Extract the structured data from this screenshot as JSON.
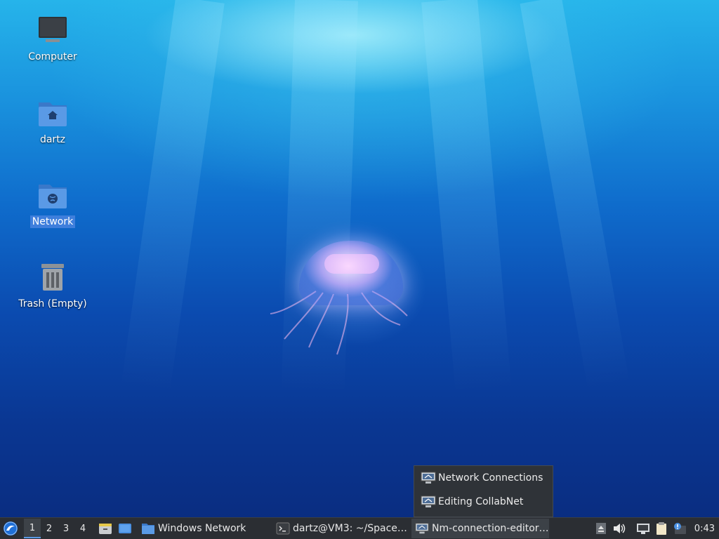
{
  "desktop": {
    "icons": [
      {
        "label": "Computer"
      },
      {
        "label": "dartz"
      },
      {
        "label": "Network"
      },
      {
        "label": "Trash (Empty)"
      }
    ]
  },
  "popup": {
    "items": [
      {
        "label": "Network Connections",
        "icon": "network-connections-icon"
      },
      {
        "label": "Editing CollabNet",
        "icon": "network-connections-icon"
      }
    ]
  },
  "taskbar": {
    "workspaces": [
      "1",
      "2",
      "3",
      "4"
    ],
    "active_workspace": "1",
    "tasks": [
      {
        "label": "Windows Network",
        "icon": "folder-icon"
      },
      {
        "label": "dartz@VM3: ~/Space…",
        "icon": "terminal-icon"
      },
      {
        "label": "Nm-connection-editor…",
        "icon": "network-connections-icon"
      }
    ],
    "clock": "0:43"
  },
  "colors": {
    "selection": "#3f7fdc",
    "panel": "#2b2e33",
    "folder": "#4a90e2"
  }
}
